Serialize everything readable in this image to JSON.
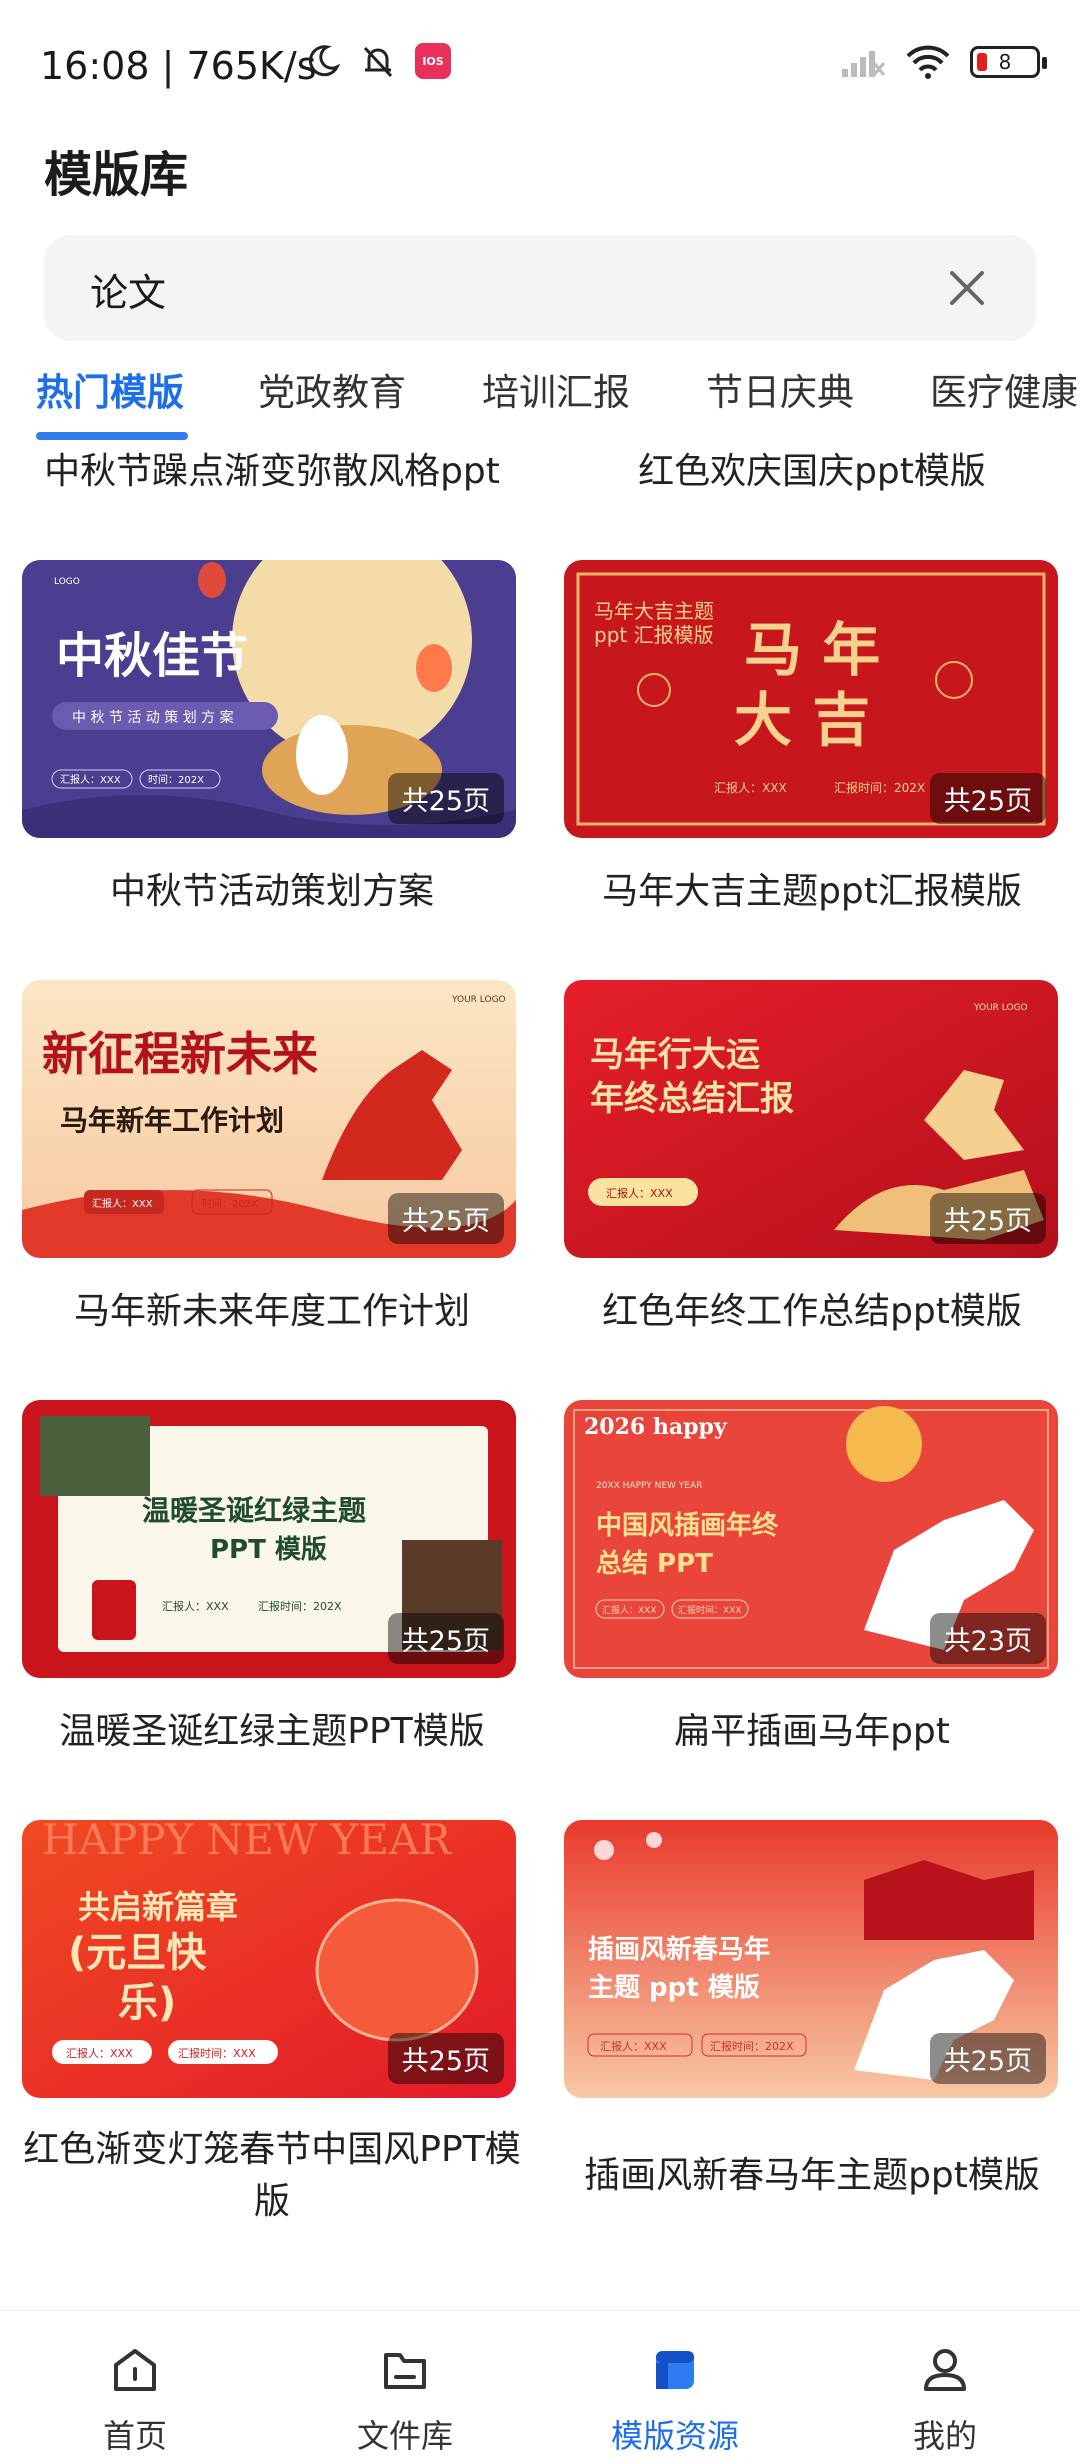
{
  "status_bar": {
    "time_speed": "16:08 | 765K/s",
    "app_badge": "IOS",
    "battery": "8"
  },
  "page": {
    "title": "模版库"
  },
  "search": {
    "value": "论文"
  },
  "tabs": [
    "热门模版",
    "党政教育",
    "培训汇报",
    "节日庆典",
    "医疗健康"
  ],
  "partial_row": [
    "中秋节躁点渐变弥散风格ppt",
    "红色欢庆国庆ppt模版"
  ],
  "templates": [
    {
      "title": "中秋节活动策划方案",
      "pages": "共25页",
      "thumb_title": "中秋佳节",
      "thumb_subtitle": "中 秋 节 活 动 策 划 方 案",
      "thumb_meta1": "汇报人：XXX",
      "thumb_meta2": "时间：202X",
      "thumb_logo": "LOGO"
    },
    {
      "title": "马年大吉主题ppt汇报模版",
      "pages": "共25页",
      "thumb_title": "马 年",
      "thumb_title2": "大 吉",
      "thumb_subtitle": "马年大吉主题",
      "thumb_subtitle2": "ppt 汇报模版",
      "thumb_meta1": "汇报人：XXX",
      "thumb_meta2": "汇报时间：202X"
    },
    {
      "title": "马年新未来年度工作计划",
      "pages": "共25页",
      "thumb_title": "新征程新未来",
      "thumb_subtitle": "马年新年工作计划",
      "thumb_meta1": "汇报人：XXX",
      "thumb_meta2": "时间：202X",
      "thumb_logo": "YOUR LOGO"
    },
    {
      "title": "红色年终工作总结ppt模版",
      "pages": "共25页",
      "thumb_title": "马年行大运",
      "thumb_title2": "年终总结汇报",
      "thumb_meta1": "汇报人：XXX",
      "thumb_logo": "YOUR LOGO"
    },
    {
      "title": "温暖圣诞红绿主题PPT模版",
      "pages": "共25页",
      "thumb_title": "温暖圣诞红绿主题",
      "thumb_title2": "PPT 模版",
      "thumb_meta1": "汇报人：XXX",
      "thumb_meta2": "汇报时间：202X"
    },
    {
      "title": "扁平插画马年ppt",
      "pages": "共23页",
      "thumb_title": "中国风插画年终",
      "thumb_title2": "总结 PPT",
      "thumb_top": "20XX HAPPY NEW YEAR",
      "thumb_year": "2026 happy",
      "thumb_meta1": "汇报人：XXX",
      "thumb_meta2": "汇报时间：XXX"
    },
    {
      "title": "红色渐变灯笼春节中国风PPT模版",
      "pages": "共25页",
      "thumb_top": "HAPPY NEW YEAR",
      "thumb_title": "共启新篇章",
      "thumb_title2": "(元旦快",
      "thumb_title3": "乐)",
      "thumb_meta1": "汇报人：XXX",
      "thumb_meta2": "汇报时间：XXX"
    },
    {
      "title": "插画风新春马年主题ppt模版",
      "pages": "共25页",
      "thumb_title": "插画风新春马年",
      "thumb_title2": "主题 ppt 模版",
      "thumb_meta1": "汇报人：XXX",
      "thumb_meta2": "汇报时间：202X"
    }
  ],
  "bottom_nav": [
    {
      "label": "首页",
      "icon": "home-icon"
    },
    {
      "label": "文件库",
      "icon": "folder-icon"
    },
    {
      "label": "模版资源",
      "icon": "template-icon"
    },
    {
      "label": "我的",
      "icon": "person-icon"
    }
  ],
  "colors": {
    "accent": "#1c6fe6",
    "badge_bg": "#000000"
  }
}
